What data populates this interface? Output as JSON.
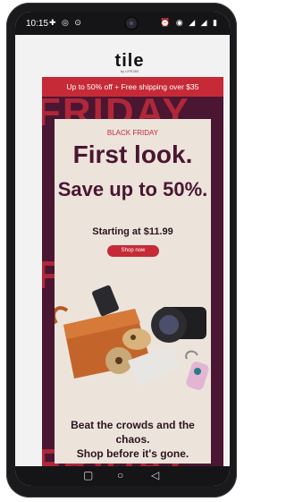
{
  "status": {
    "time": "10:15",
    "left_icons": "✚ ◎ ⊙",
    "right_icons": "⏰ ◉ ◢ ◢ ▮"
  },
  "brand": {
    "logo": "tile",
    "sub": "by LIFE360"
  },
  "banner": {
    "text": "Up to 50% off + Free shipping over $35"
  },
  "background_word": "FRIDAY",
  "card": {
    "eyebrow": "BLACK FRIDAY",
    "headline": "First look.",
    "subheadline": "Save up to 50%.",
    "price": "Starting at $11.99",
    "button": "Shop now",
    "footer_line1": "Beat the crowds and the chaos.",
    "footer_line2": "Shop before it's gone."
  },
  "nav": {
    "square": "▢",
    "circle": "○",
    "back": "◁"
  },
  "colors": {
    "brand_red": "#c62a37",
    "plum": "#4a1632",
    "card_bg": "#ece4db"
  }
}
